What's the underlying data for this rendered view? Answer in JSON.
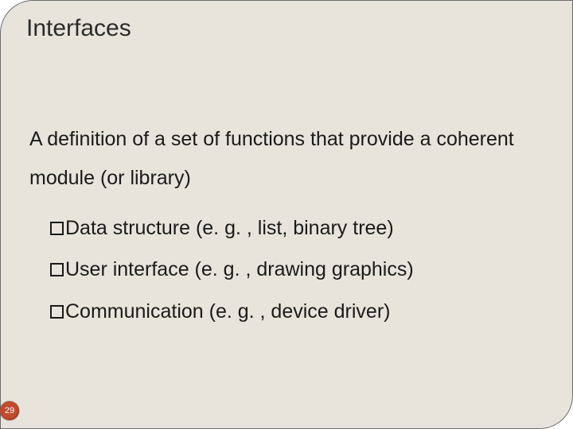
{
  "slide": {
    "title": "Interfaces",
    "leadline": "A definition of a set of functions that provide a coherent module (or library)",
    "bullets": [
      "Data structure (e. g. , list, binary tree)",
      "User interface (e. g. , drawing graphics)",
      "Communication (e. g. , device driver)"
    ],
    "page_number": "29"
  }
}
